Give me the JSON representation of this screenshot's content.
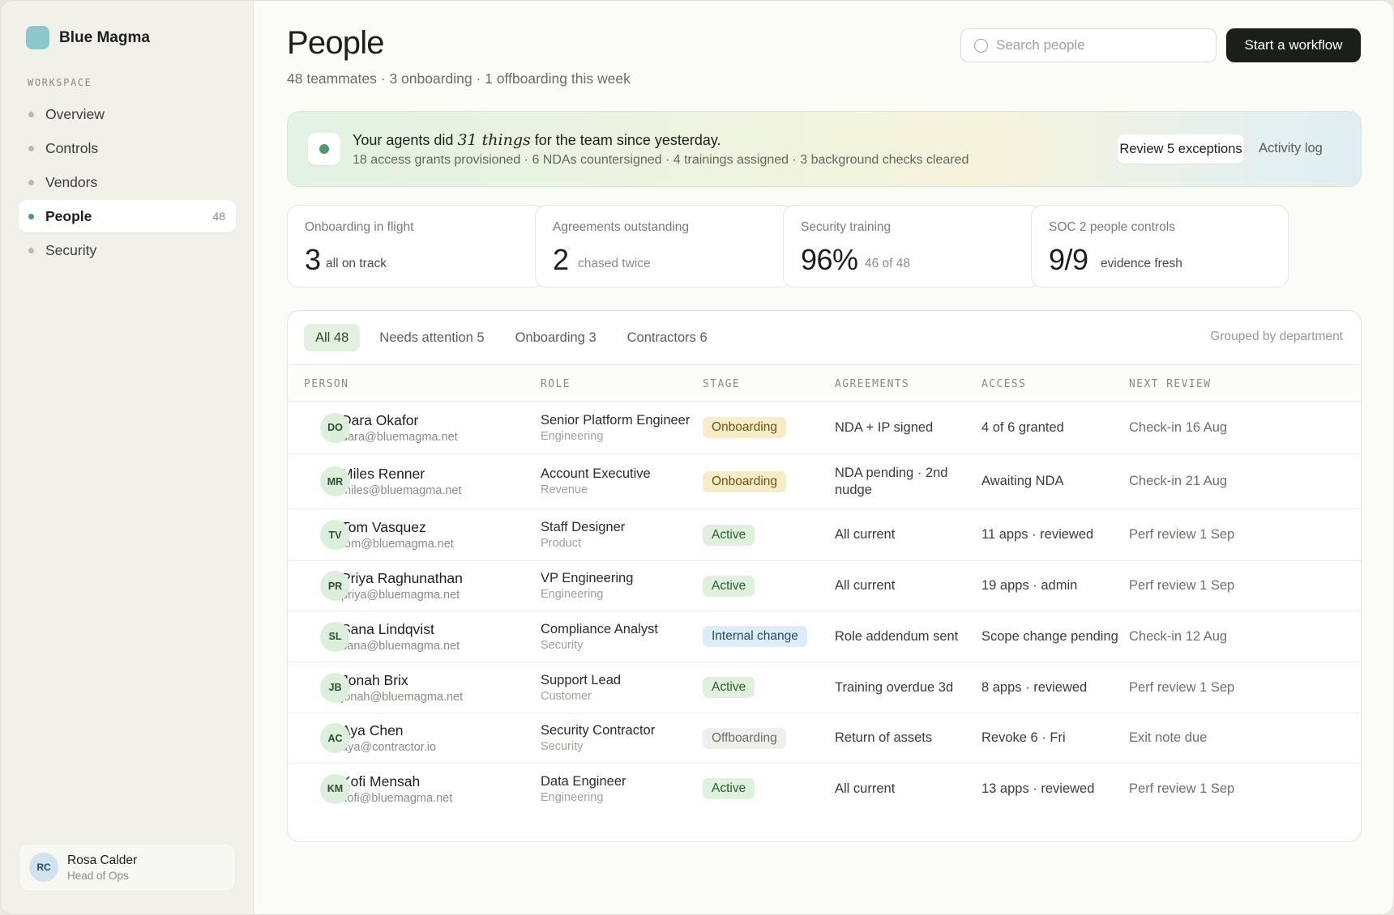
{
  "brand": {
    "name": "Blue Magma"
  },
  "sidebar": {
    "section_label": "WORKSPACE",
    "items": [
      {
        "label": "Overview",
        "count": ""
      },
      {
        "label": "Controls",
        "count": ""
      },
      {
        "label": "Vendors",
        "count": ""
      },
      {
        "label": "People",
        "count": "48"
      },
      {
        "label": "Security",
        "count": ""
      }
    ],
    "active": "People",
    "user": {
      "initials": "RC",
      "name": "Rosa Calder",
      "role": "Head of Ops"
    }
  },
  "header": {
    "title": "People",
    "subtitle": "48 teammates · 3 onboarding · 1 offboarding this week",
    "search_placeholder": "Search people",
    "search_value": "",
    "primary_button": "Start a workflow"
  },
  "banner": {
    "title_before": "Your agents did ",
    "title_emphasis": "31 things",
    "title_after": " for the team since yesterday.",
    "summary": "18 access grants provisioned · 6 NDAs countersigned · 4 trainings assigned · 3 background checks cleared",
    "review_button": "Review 5 exceptions",
    "activity_link": "Activity log"
  },
  "stats": [
    {
      "label": "Onboarding in flight",
      "value": "3",
      "note": "all on track"
    },
    {
      "label": "Agreements outstanding",
      "value": "2",
      "note": "chased twice"
    },
    {
      "label": "Security training",
      "value": "96%",
      "note": "46 of 48"
    },
    {
      "label": "SOC 2 people controls",
      "value": "9/9",
      "note": "evidence fresh"
    }
  ],
  "table": {
    "tabs": [
      "All 48",
      "Needs attention 5",
      "Onboarding 3",
      "Contractors 6"
    ],
    "active_tab": "All 48",
    "grouping": "Grouped by department",
    "columns": [
      "PERSON",
      "ROLE",
      "STAGE",
      "AGREEMENTS",
      "ACCESS",
      "NEXT REVIEW"
    ],
    "rows": [
      {
        "initials": "DO",
        "name": "Dara Okafor",
        "email": "dara@bluemagma.net",
        "role": "Senior Platform Engineer",
        "dept": "Engineering",
        "stage": "Onboarding",
        "agreements": "NDA + IP signed",
        "access": "4 of 6 granted",
        "review": "Check-in 16 Aug"
      },
      {
        "initials": "MR",
        "name": "Miles Renner",
        "email": "miles@bluemagma.net",
        "role": "Account Executive",
        "dept": "Revenue",
        "stage": "Onboarding",
        "agreements": "NDA pending · 2nd nudge",
        "access": "Awaiting NDA",
        "review": "Check-in 21 Aug"
      },
      {
        "initials": "TV",
        "name": "Tom Vasquez",
        "email": "tom@bluemagma.net",
        "role": "Staff Designer",
        "dept": "Product",
        "stage": "Active",
        "agreements": "All current",
        "access": "11 apps · reviewed",
        "review": "Perf review 1 Sep"
      },
      {
        "initials": "PR",
        "name": "Priya Raghunathan",
        "email": "priya@bluemagma.net",
        "role": "VP Engineering",
        "dept": "Engineering",
        "stage": "Active",
        "agreements": "All current",
        "access": "19 apps · admin",
        "review": "Perf review 1 Sep"
      },
      {
        "initials": "SL",
        "name": "Sana Lindqvist",
        "email": "sana@bluemagma.net",
        "role": "Compliance Analyst",
        "dept": "Security",
        "stage": "Internal change",
        "agreements": "Role addendum sent",
        "access": "Scope change pending",
        "review": "Check-in 12 Aug"
      },
      {
        "initials": "JB",
        "name": "Jonah Brix",
        "email": "jonah@bluemagma.net",
        "role": "Support Lead",
        "dept": "Customer",
        "stage": "Active",
        "agreements": "Training overdue 3d",
        "access": "8 apps · reviewed",
        "review": "Perf review 1 Sep"
      },
      {
        "initials": "AC",
        "name": "Aya Chen",
        "email": "aya@contractor.io",
        "role": "Security Contractor",
        "dept": "Security",
        "stage": "Offboarding",
        "agreements": "Return of assets",
        "access": "Revoke 6 · Fri",
        "review": "Exit note due"
      },
      {
        "initials": "KM",
        "name": "Kofi Mensah",
        "email": "kofi@bluemagma.net",
        "role": "Data Engineer",
        "dept": "Engineering",
        "stage": "Active",
        "agreements": "All current",
        "access": "13 apps · reviewed",
        "review": "Perf review 1 Sep"
      }
    ]
  },
  "colors": {
    "accent_green": "#4f9a6b",
    "brand_mark": "#8fc6c9",
    "primary_button": "#1c1e1b",
    "badge_onboarding": "#f6ecc7",
    "badge_active": "#dff0dc",
    "badge_internal": "#dcedf7",
    "badge_offboarding": "#efefeb"
  }
}
